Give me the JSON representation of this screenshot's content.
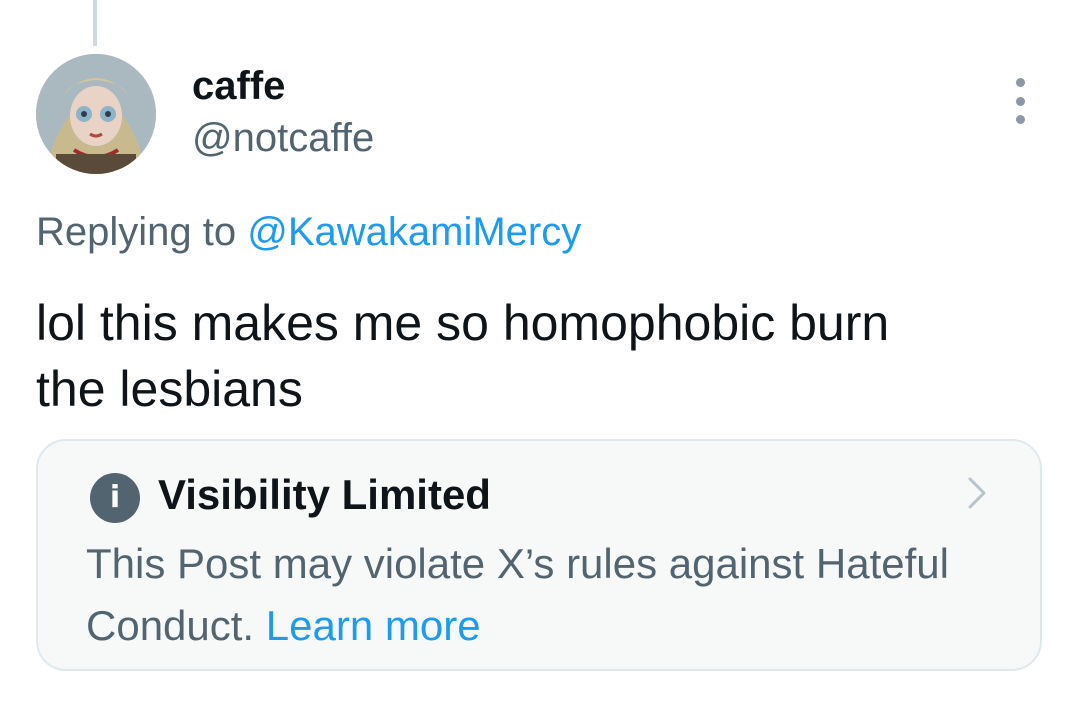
{
  "author": {
    "display_name": "caffe",
    "handle": "@notcaffe"
  },
  "reply": {
    "prefix": "Replying to ",
    "mention": "@KawakamiMercy"
  },
  "tweet": {
    "line1": "lol this makes me so homophobic burn",
    "line2": "the lesbians"
  },
  "notice": {
    "icon": "info-icon",
    "title": "Visibility Limited",
    "body": "This Post may violate X’s rules against Hateful Conduct. ",
    "learn_more": "Learn more"
  },
  "colors": {
    "text": "#0f1419",
    "secondary": "#536471",
    "accent": "#1d9bf0",
    "notice_bg": "#f7f9f9"
  }
}
